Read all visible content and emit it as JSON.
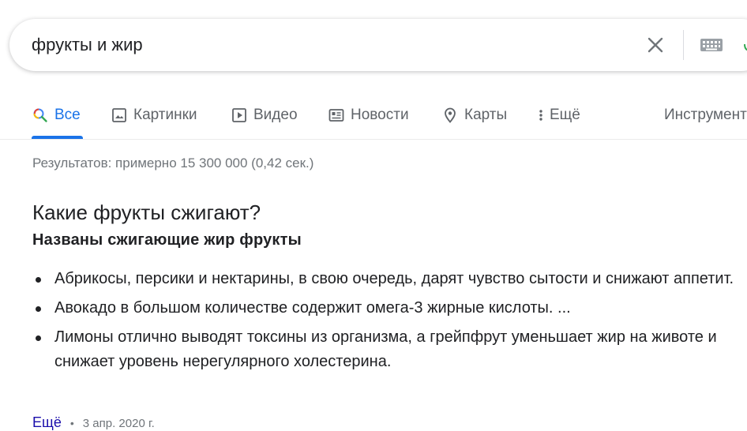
{
  "search": {
    "query": "фрукты и жир"
  },
  "tabs": [
    {
      "label": "Все",
      "icon": "search-icon",
      "active": true
    },
    {
      "label": "Картинки",
      "icon": "image-icon"
    },
    {
      "label": "Видео",
      "icon": "video-icon"
    },
    {
      "label": "Новости",
      "icon": "news-icon"
    },
    {
      "label": "Карты",
      "icon": "map-pin-icon"
    },
    {
      "label": "Ещё",
      "icon": "more-vert-icon"
    },
    {
      "label": "Инструменты"
    }
  ],
  "result_stats": "Результатов: примерно 15 300 000 (0,42 сек.)",
  "snippet": {
    "title": "Какие фрукты сжигают?",
    "subtitle": "Названы сжигающие жир фрукты",
    "items": [
      "Абрикосы, персики и нектарины, в свою очередь, дарят чувство сытости и снижают аппетит.",
      "Авокадо в большом количестве содержит омега-3 жирные кислоты. ...",
      "Лимоны отлично выводят токсины из организма, а грейпфрут уменьшает жир на животе и снижает уровень нерегулярного холестерина."
    ],
    "more_label": "Ещё",
    "separator": "•",
    "date": "3 апр. 2020 г."
  },
  "colors": {
    "accent": "#1a73e8",
    "link": "#1a0dab",
    "muted": "#70757a"
  }
}
